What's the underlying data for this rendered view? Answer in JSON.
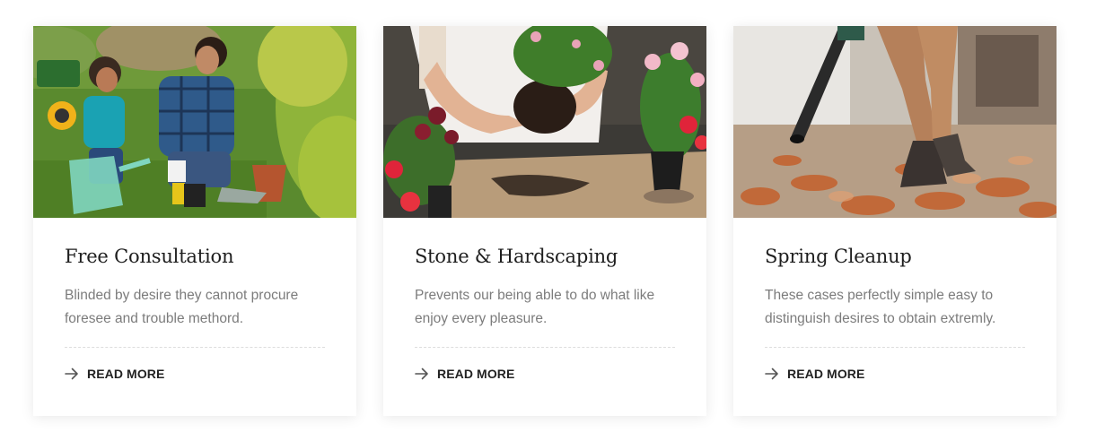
{
  "cards": [
    {
      "title": "Free Consultation",
      "description": "Blinded by desire they cannot procure foresee and trouble methord.",
      "link_label": "READ MORE",
      "image_subject": "father-and-child-gardening"
    },
    {
      "title": "Stone & Hardscaping",
      "description": "Prevents our being able to do what like enjoy every pleasure.",
      "link_label": "READ MORE",
      "image_subject": "hands-potting-plant"
    },
    {
      "title": "Spring Cleanup",
      "description": "These cases perfectly simple easy to distinguish desires to obtain extremly.",
      "link_label": "READ MORE",
      "image_subject": "leaf-blower-on-autumn-leaves"
    }
  ],
  "colors": {
    "title": "#1e1e1e",
    "text": "#7c7c7c",
    "link": "#222222",
    "divider": "#dddddd"
  },
  "icons": {
    "link_icon": "arrow-right-icon"
  }
}
